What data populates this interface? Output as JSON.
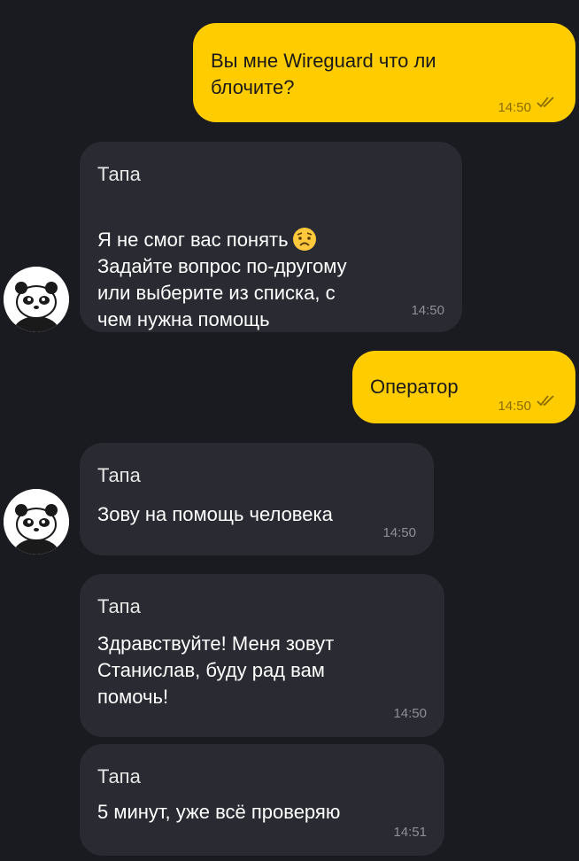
{
  "colors": {
    "background": "#1a1b20",
    "outgoing_bubble": "#ffcc00",
    "incoming_bubble": "#2a2b32"
  },
  "messages": [
    {
      "direction": "outgoing",
      "text": "Вы мне Wireguard что ли\nблочите?",
      "time": "14:50",
      "status_icon": "double-check-icon"
    },
    {
      "direction": "incoming",
      "sender": "Тапа",
      "text": "Я не смог вас понять",
      "text_rest": "Задайте вопрос по-другому\nили выберите из списка, с\nчем нужна помощь",
      "emoji_icon": "worried-face-emoji",
      "time": "14:50",
      "avatar_icon": "panda-avatar-icon"
    },
    {
      "direction": "outgoing",
      "text": "Оператор",
      "time": "14:50",
      "status_icon": "double-check-icon"
    },
    {
      "direction": "incoming",
      "sender": "Тапа",
      "text": "Зову на помощь человека",
      "time": "14:50",
      "avatar_icon": "panda-avatar-icon"
    },
    {
      "direction": "incoming",
      "sender": "Тапа",
      "text": "Здравствуйте! Меня зовут\nСтанислав, буду рад вам\nпомочь!",
      "time": "14:50"
    },
    {
      "direction": "incoming",
      "sender": "Тапа",
      "text": "5 минут, уже всё проверяю",
      "time": "14:51"
    }
  ]
}
